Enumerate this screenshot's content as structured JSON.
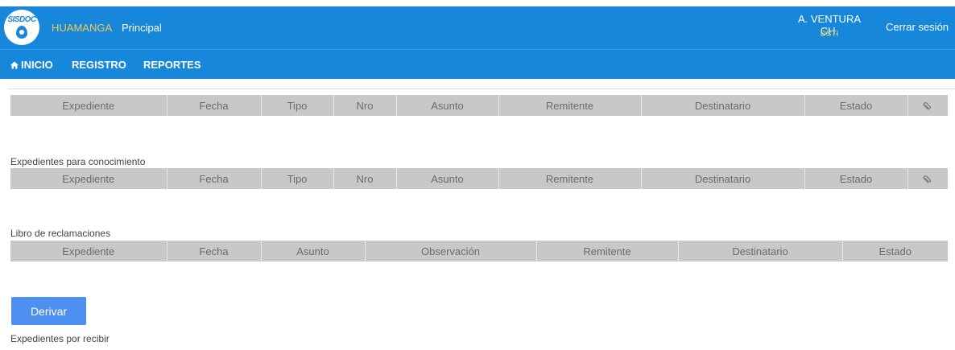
{
  "header": {
    "logo_text": "SISDOC",
    "brand": "HUAMANGA",
    "subtitle": "Principal",
    "user_name": "A. VENTURA CH.",
    "user_dept": "DSTI",
    "logout_label": "Cerrar sesión",
    "colors": {
      "bar": "#1787dc",
      "accent": "#f2c94c"
    }
  },
  "nav": {
    "items": [
      {
        "label": "INICIO",
        "icon": "home-icon"
      },
      {
        "label": "REGISTRO"
      },
      {
        "label": "REPORTES"
      }
    ]
  },
  "tables": {
    "main": {
      "columns": [
        "Expediente",
        "Fecha",
        "Tipo",
        "Nro",
        "Asunto",
        "Remitente",
        "Destinatario",
        "Estado"
      ],
      "attachment_icon": "paperclip-icon"
    },
    "conocimiento": {
      "title": "Expedientes para conocimiento",
      "columns": [
        "Expediente",
        "Fecha",
        "Tipo",
        "Nro",
        "Asunto",
        "Remitente",
        "Destinatario",
        "Estado"
      ],
      "attachment_icon": "paperclip-icon"
    },
    "reclamaciones": {
      "title": "Libro de reclamaciones",
      "columns": [
        "Expediente",
        "Fecha",
        "Asunto",
        "Observación",
        "Remitente",
        "Destinatario",
        "Estado"
      ]
    }
  },
  "actions": {
    "derivar_label": "Derivar"
  },
  "footer_section": {
    "title": "Expedientes por recibir"
  }
}
